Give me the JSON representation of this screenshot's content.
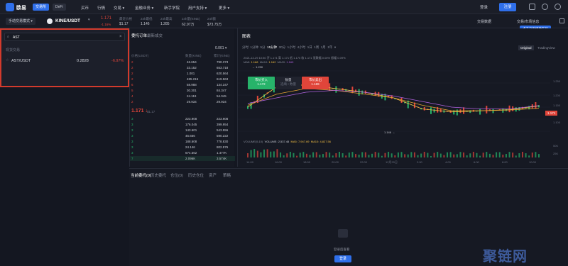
{
  "nav": {
    "logo_text": "欧易",
    "pill_exchange": "交易所",
    "pill_defi": "DeFi",
    "items": [
      "买币",
      "行情",
      "交易 ▾",
      "金融业务 ▾",
      "新手学院",
      "用户支持 ▾",
      "更多 ▾"
    ],
    "login": "登录",
    "register": "注册"
  },
  "ticker": {
    "mode": "手动交易模式 ▾",
    "pair": "KINE/USDT",
    "price": "1.171",
    "change": "-1.16%",
    "stats": [
      {
        "label": "最近价格",
        "value": "$1.17"
      },
      {
        "label": "24h最低",
        "value": "1.146"
      },
      {
        "label": "24h最高",
        "value": "1.285"
      },
      {
        "label": "24h量(KINE)",
        "value": "62.97万"
      },
      {
        "label": "24h额",
        "value": "$73.75万"
      }
    ],
    "trade_data": "交易数据",
    "trade_info": "交易/市场信息",
    "tooltip": "点击这里修改布局"
  },
  "search": {
    "value": "AST",
    "section_label": "现货交易",
    "result_pair": "AST/USDT",
    "result_price": "0.2828",
    "result_change": "-6.97%"
  },
  "orderbook": {
    "tab_book": "委托订单",
    "tab_recent": "最新成交",
    "step": "0.001 ▾",
    "col_price": "价格(USDT)",
    "col_amount": "数量(KINE)",
    "col_total": "累计(KINE)",
    "asks": [
      {
        "amount": "46.654",
        "total": "790.373"
      },
      {
        "amount": "33.152",
        "total": "653.718"
      },
      {
        "amount": "1.001",
        "total": "620.564"
      },
      {
        "amount": "485.215",
        "total": "619.563"
      },
      {
        "amount": "58.988",
        "total": "134.347"
      },
      {
        "amount": "30.301",
        "total": "84.347"
      },
      {
        "amount": "24.119",
        "total": "54.045"
      },
      {
        "amount": "29.934",
        "total": "29.934"
      }
    ],
    "mid_price": "1.171 ↓",
    "mid_usd": "$1.17",
    "bids": [
      {
        "amount": "223.908",
        "total": "223.908"
      },
      {
        "amount": "176.045",
        "total": "399.954"
      },
      {
        "amount": "143.601",
        "total": "543.556"
      },
      {
        "amount": "46.666",
        "total": "590.222"
      },
      {
        "amount": "188.608",
        "total": "778.830"
      },
      {
        "amount": "24.146",
        "total": "802.976"
      },
      {
        "amount": "674.562",
        "total": "1.477K"
      },
      {
        "amount": "2.096K",
        "total": "3.574K"
      }
    ]
  },
  "chart_panel": {
    "title": "图表",
    "timeframes": [
      "分时",
      "1分钟",
      "5分",
      "15分钟",
      "30分",
      "1小时",
      "4小时",
      "1日",
      "1周",
      "1月",
      "1年",
      "▾"
    ],
    "style_original": "Original",
    "style_tv": "TradingView",
    "ohlc_line": "2021-12-29 10:30  开 1.171  高 1.171  低 1.170  收 1.171  涨跌幅 0.00%  振幅 0.09%",
    "ma_line_ma5_label": "MA5:",
    "ma_line_ma5": "1.168",
    "ma_line_ma10_label": "MA10:",
    "ma_line_ma10": "1.162",
    "ma_line_ma20_label": "MA20:",
    "ma_line_ma20": "1.169",
    "high_mark": "← 1.230",
    "low_mark": "1.146 →",
    "buy_label": "市价买入",
    "buy_price": "1.172",
    "qty_label": "数量",
    "qty_sub": "选填 • 数量",
    "sell_label": "市价卖出",
    "sell_price": "1.169",
    "current_price_tag": "1.171",
    "price_axis": [
      "1.250",
      "1.200",
      "1.150",
      "1.100"
    ],
    "volume_line_label": "VOLUME(5,10)",
    "volume_line_vol": "VOLUME: 2,537.48",
    "volume_line_ma5": "MA5: 7,947.69",
    "volume_line_ma10": "MA10: 4,827.56",
    "vol_axis": [
      "50K",
      "25K"
    ],
    "time_axis": [
      "14:00",
      "16:00",
      "18:00",
      "20:00",
      "22:00",
      "12月29日",
      "2:00",
      "4:00",
      "6:00",
      "8:00",
      "10:00"
    ],
    "chart_data": {
      "type": "line",
      "x": [
        "14:00",
        "16:00",
        "18:00",
        "20:00",
        "22:00",
        "12月29日",
        "2:00",
        "4:00",
        "6:00",
        "8:00",
        "10:00"
      ],
      "series": [
        {
          "name": "MA5",
          "values": [
            1.165,
            1.22,
            1.225,
            1.215,
            1.205,
            1.19,
            1.16,
            1.152,
            1.155,
            1.158,
            1.168
          ]
        },
        {
          "name": "MA10",
          "values": [
            1.17,
            1.2,
            1.215,
            1.21,
            1.2,
            1.19,
            1.17,
            1.155,
            1.155,
            1.157,
            1.162
          ]
        },
        {
          "name": "MA20",
          "values": [
            1.175,
            1.19,
            1.205,
            1.21,
            1.205,
            1.195,
            1.18,
            1.165,
            1.16,
            1.16,
            1.169
          ]
        }
      ],
      "ylim": [
        1.1,
        1.27
      ]
    }
  },
  "bottom": {
    "tabs": [
      "当前委托(0)",
      "历史委托",
      "仓位(0)",
      "历史仓位",
      "资产",
      "策略"
    ],
    "empty_text": "登录后查看",
    "login_btn": "登录"
  },
  "watermark": "聚链网",
  "colors": {
    "accent": "#2f6fea",
    "up": "#27b36a",
    "down": "#e0453a",
    "highlight_border": "#d23a2c"
  }
}
